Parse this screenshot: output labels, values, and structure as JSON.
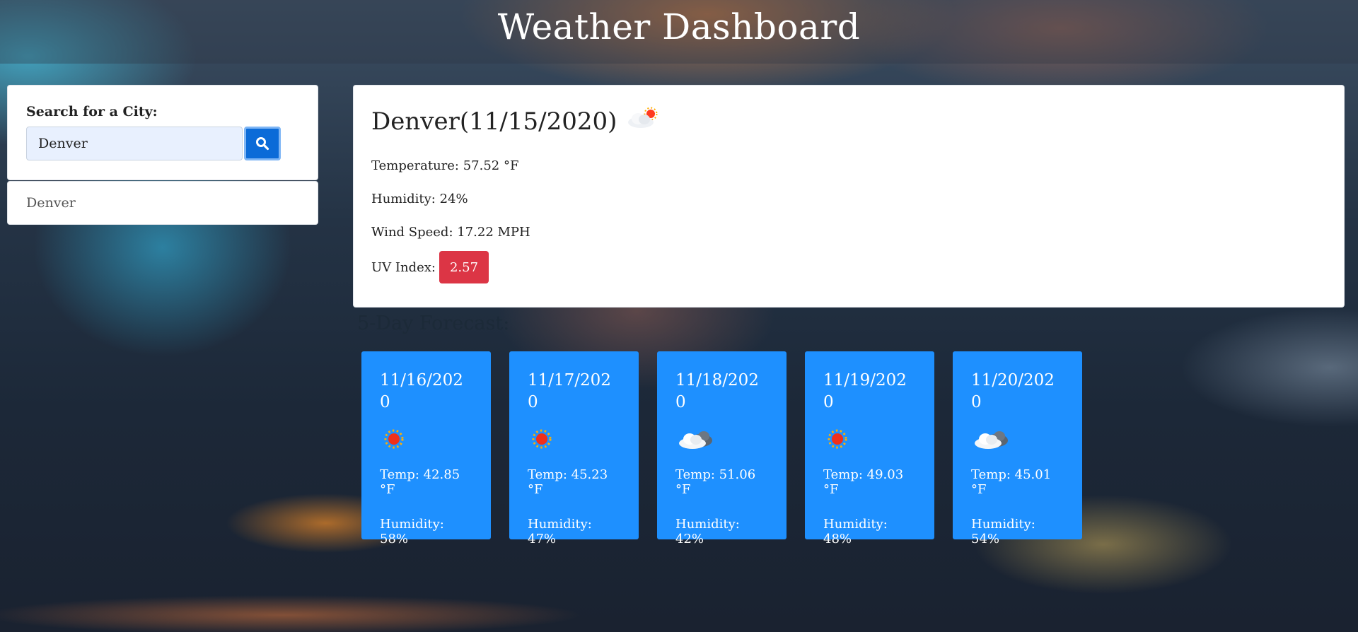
{
  "header": {
    "title": "Weather Dashboard"
  },
  "search": {
    "label": "Search for a City:",
    "input_value": "Denver",
    "button_icon": "search-icon",
    "history": [
      "Denver"
    ]
  },
  "current": {
    "title": "Denver(11/15/2020)",
    "icon": "partly-cloudy-icon",
    "temperature": "Temperature: 57.52 °F",
    "humidity": "Humidity: 24%",
    "wind": "Wind Speed: 17.22 MPH",
    "uv_label": "UV Index:",
    "uv_value": "2.57",
    "uv_color": "#dc3545"
  },
  "forecast": {
    "title": "5-Day Forecast:",
    "card_color": "#1e90ff",
    "days": [
      {
        "date": "11/16/2020",
        "icon": "sun-icon",
        "temp": "Temp: 42.85 °F",
        "humidity": "Humidity: 58%"
      },
      {
        "date": "11/17/2020",
        "icon": "sun-icon",
        "temp": "Temp: 45.23 °F",
        "humidity": "Humidity: 47%"
      },
      {
        "date": "11/18/2020",
        "icon": "cloud-icon",
        "temp": "Temp: 51.06 °F",
        "humidity": "Humidity: 42%"
      },
      {
        "date": "11/19/2020",
        "icon": "sun-icon",
        "temp": "Temp: 49.03 °F",
        "humidity": "Humidity: 48%"
      },
      {
        "date": "11/20/2020",
        "icon": "cloud-icon",
        "temp": "Temp: 45.01 °F",
        "humidity": "Humidity: 54%"
      }
    ]
  }
}
